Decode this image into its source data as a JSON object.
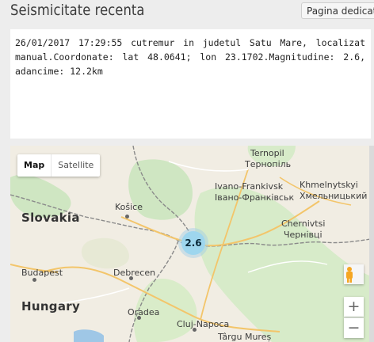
{
  "header": {
    "title": "Seismicitate recenta",
    "page_button_label": "Pagina dedicata"
  },
  "info": {
    "text": "26/01/2017 17:29:55 cutremur in judetul Satu Mare, localizat manual.Coordonate: lat 48.0641; lon 23.1702.Magnitudine: 2.6, adancime: 12.2km"
  },
  "map": {
    "type_options": [
      "Map",
      "Satellite"
    ],
    "selected_type": "Map",
    "marker_label": "2.6",
    "zoom_in_label": "+",
    "zoom_out_label": "−",
    "labels": {
      "slovakia": "Slovakia",
      "hungary": "Hungary",
      "kosice": "Košice",
      "budapest": "Budapest",
      "debrecen": "Debrecen",
      "oradea": "Oradea",
      "cluj": "Cluj-Napoca",
      "targu_mures": "Târgu Mureș",
      "ternopil": "Ternopil",
      "ternopil_local": "Тернопіль",
      "ivano": "Ivano-Frankivsk",
      "ivano_local": "Івано-Франківськ",
      "khmelnytskyi": "Khmelnytskyi",
      "khmelnytskyi_local": "Хмельницький",
      "chernivtsi": "Chernivtsi",
      "chernivtsi_local": "Чернівці"
    },
    "colors": {
      "land": "#f1ede3",
      "forest": "#cfe6c2",
      "border": "#8a8a8a",
      "road": "#f3c56a",
      "water": "#9fc7e6"
    }
  }
}
